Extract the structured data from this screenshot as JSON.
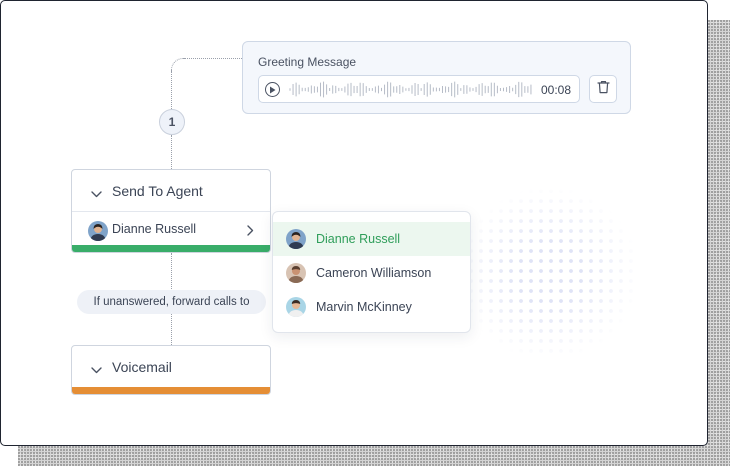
{
  "greeting": {
    "title": "Greeting Message",
    "duration": "00:08",
    "play_icon": "play-icon",
    "delete_icon": "trash-icon"
  },
  "flow": {
    "step_number": "1",
    "send_to_agent": {
      "title": "Send To Agent",
      "selected_agent": "Dianne Russell",
      "accent": "#39ad69"
    },
    "forward_label": "If unanswered, forward calls to",
    "voicemail": {
      "title": "Voicemail",
      "accent": "#e58e35"
    }
  },
  "agent_dropdown": {
    "items": [
      {
        "name": "Dianne Russell",
        "selected": true
      },
      {
        "name": "Cameron Williamson",
        "selected": false
      },
      {
        "name": "Marvin McKinney",
        "selected": false
      }
    ],
    "selected_color": "#2f9e5a"
  }
}
